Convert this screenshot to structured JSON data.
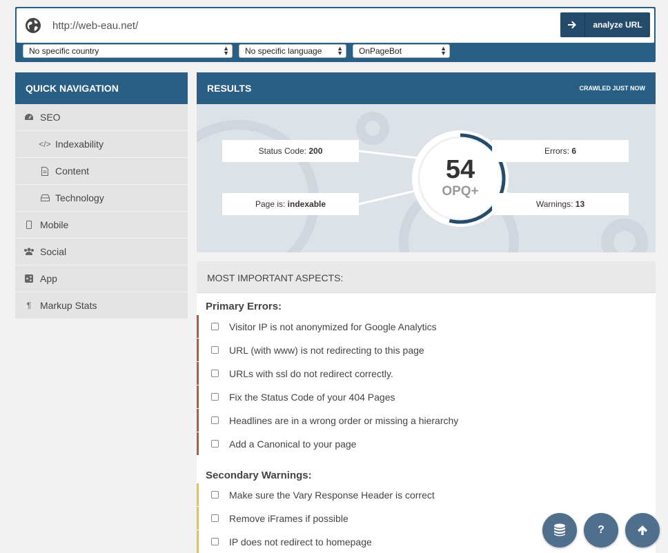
{
  "url_bar": {
    "url": "http://web-eau.net/",
    "analyze_label": "analyze URL",
    "country": "No specific country",
    "language": "No specific language",
    "bot": "OnPageBot"
  },
  "sidebar": {
    "title": "QUICK NAVIGATION",
    "items": [
      {
        "label": "SEO",
        "icon": "dashboard-icon"
      },
      {
        "label": "Indexability",
        "icon": "code-icon"
      },
      {
        "label": "Content",
        "icon": "file-icon"
      },
      {
        "label": "Technology",
        "icon": "hdd-icon"
      },
      {
        "label": "Mobile",
        "icon": "mobile-icon"
      },
      {
        "label": "Social",
        "icon": "users-icon"
      },
      {
        "label": "App",
        "icon": "share-icon"
      },
      {
        "label": "Markup Stats",
        "icon": "paragraph-icon"
      }
    ]
  },
  "results": {
    "title": "RESULTS",
    "crawled": "CRAWLED JUST NOW",
    "status_code_label": "Status Code:",
    "status_code": "200",
    "page_is_label": "Page is:",
    "page_is": "indexable",
    "errors_label": "Errors:",
    "errors": "6",
    "warnings_label": "Warnings:",
    "warnings": "13",
    "score": "54",
    "score_label": "OPQ+",
    "score_fraction": 0.54
  },
  "aspects": {
    "title": "MOST IMPORTANT ASPECTS:",
    "primary_title": "Primary Errors:",
    "primary": [
      "Visitor IP is not anonymized for Google Analytics",
      "URL (with www) is not redirecting to this page",
      "URLs with ssl do not redirect correctly.",
      "Fix the Status Code of your 404 Pages",
      "Headlines are in a wrong order or missing a hierarchy",
      "Add a Canonical to your page"
    ],
    "secondary_title": "Secondary Warnings:",
    "secondary": [
      "Make sure the Vary Response Header is correct",
      "Remove iFrames if possible",
      "IP does not redirect to homepage"
    ]
  },
  "fabs": {
    "db_icon": "database-icon",
    "help_label": "?",
    "up_icon": "arrow-up-icon"
  },
  "colors": {
    "brand": "#2a5f85",
    "error": "#b35a3c",
    "warning": "#e8c437",
    "fab": "#4f6f8d"
  }
}
